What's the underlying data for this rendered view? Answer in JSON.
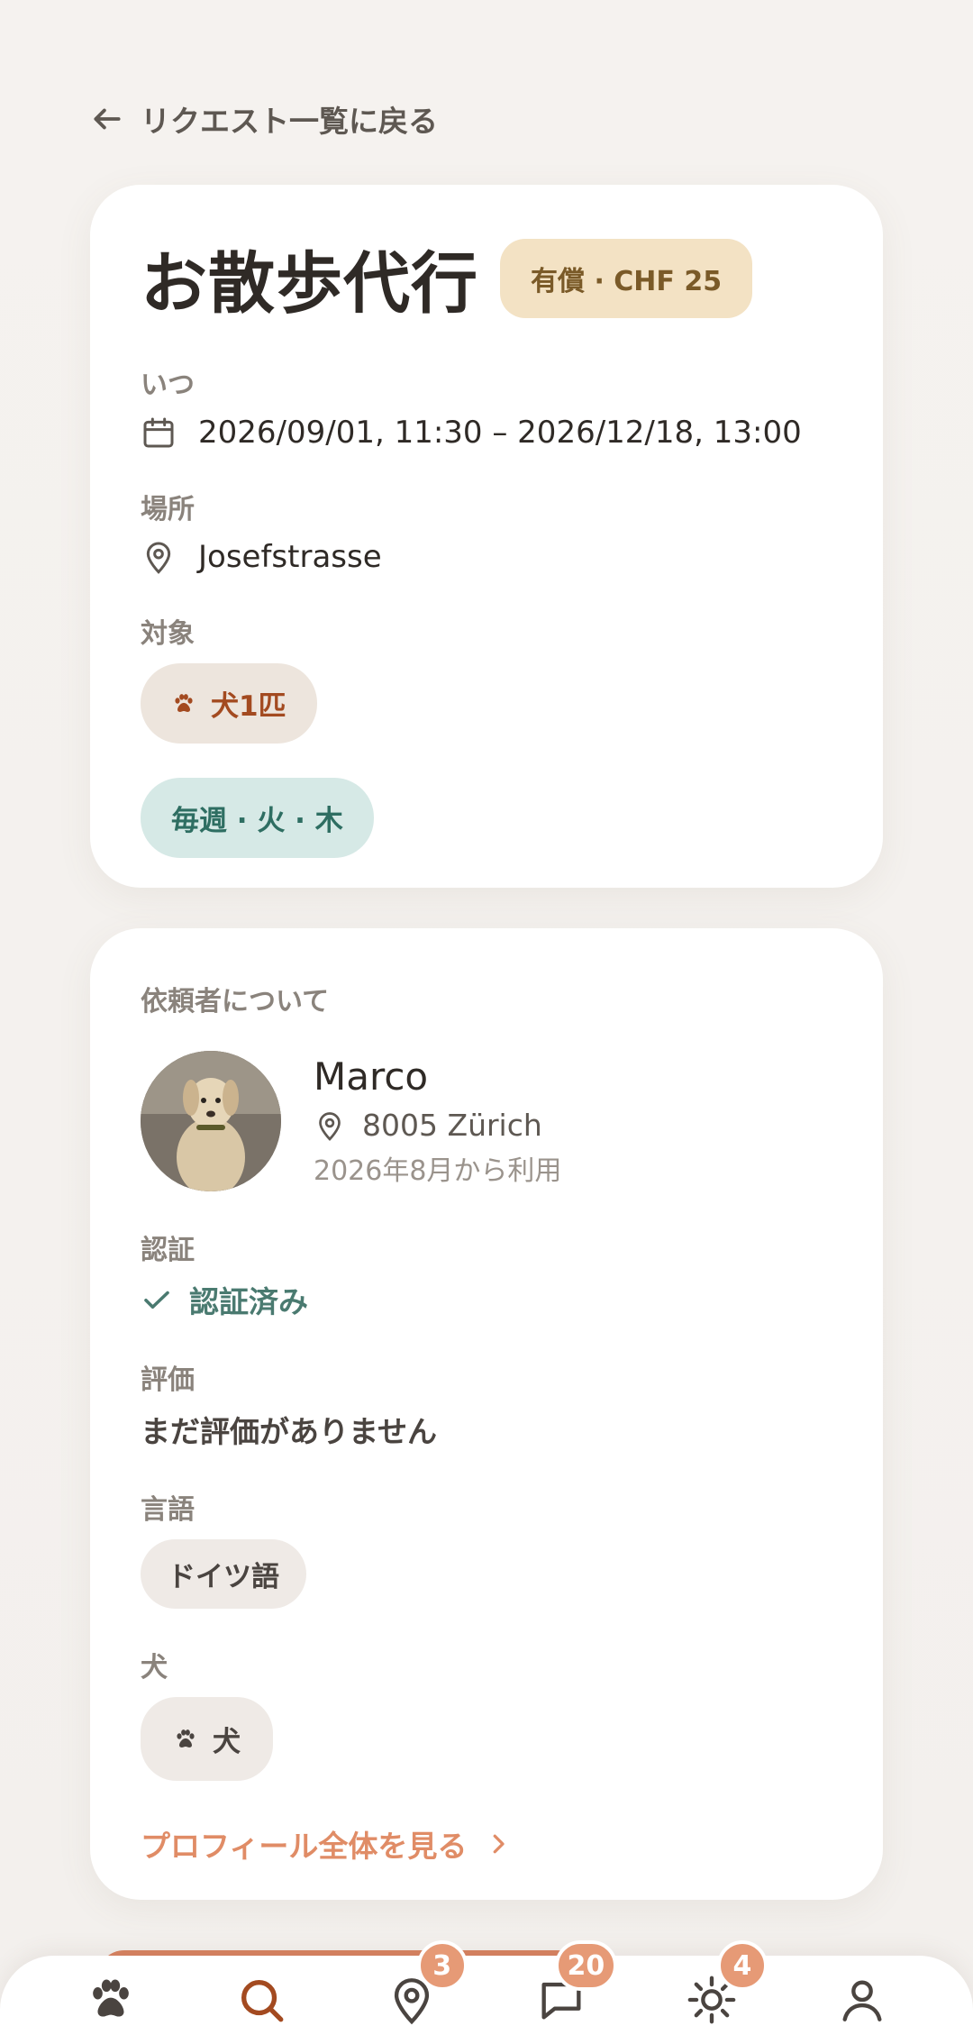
{
  "nav": {
    "back_label": "リクエスト一覧に戻る"
  },
  "request": {
    "title": "お散歩代行",
    "price_badge": "有償 · CHF 25",
    "when_label": "いつ",
    "when_value": "2026/09/01, 11:30 – 2026/12/18, 13:00",
    "where_label": "場所",
    "where_value": "Josefstrasse",
    "target_label": "対象",
    "target_value": "犬1匹",
    "schedule": "毎週 · 火 · 木"
  },
  "host": {
    "section_title": "依頼者について",
    "name": "Marco",
    "location": "8005 Zürich",
    "member_since": "2026年8月から利用",
    "verification_label": "認証",
    "verification_value": "認証済み",
    "rating_label": "評価",
    "rating_value": "まだ評価がありません",
    "language_label": "言語",
    "language_value": "ドイツ語",
    "dogs_label": "犬",
    "dogs_value": "犬",
    "profile_link": "プロフィール全体を見る"
  },
  "tabbar": {
    "tabs": [
      {
        "icon": "paw-icon",
        "badge": ""
      },
      {
        "icon": "search-icon",
        "badge": ""
      },
      {
        "icon": "location-pin-icon",
        "badge": "3"
      },
      {
        "icon": "chat-icon",
        "badge": "20"
      },
      {
        "icon": "sun-icon",
        "badge": "4"
      },
      {
        "icon": "profile-icon",
        "badge": ""
      }
    ]
  },
  "colors": {
    "accent": "#e08c66",
    "price_badge_bg": "#f3e2c4",
    "schedule_bg": "#d6e9e6",
    "badge": "#e69a76"
  }
}
